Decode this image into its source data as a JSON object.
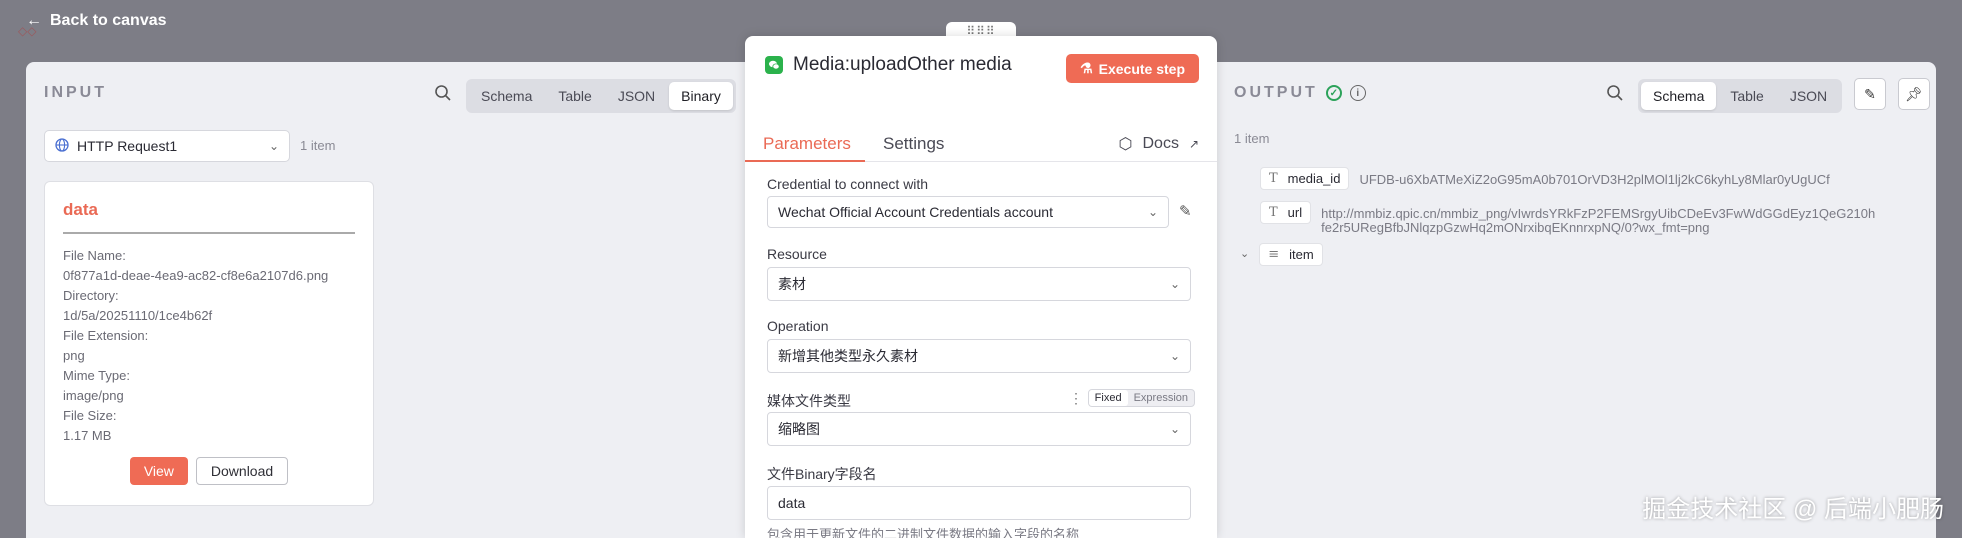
{
  "nav": {
    "back_label": "Back to canvas"
  },
  "input": {
    "header": "INPUT",
    "view_tabs": [
      "Schema",
      "Table",
      "JSON",
      "Binary"
    ],
    "active_tab": "Binary",
    "node_select": "HTTP Request1",
    "item_count": "1 item",
    "binary": {
      "title": "data",
      "lines": [
        "File Name:",
        "0f877a1d-deae-4ea9-ac82-cf8e6a2107d6.png",
        "Directory:",
        "1d/5a/20251110/1ce4b62f",
        "File Extension:",
        "png",
        "Mime Type:",
        "image/png",
        "File Size:",
        "1.17 MB"
      ],
      "view_label": "View",
      "download_label": "Download"
    }
  },
  "node": {
    "title": "Media:uploadOther media",
    "execute_label": "Execute step",
    "tabs": {
      "parameters": "Parameters",
      "settings": "Settings"
    },
    "docs_label": "Docs",
    "fields": {
      "credential_label": "Credential to connect with",
      "credential_value": "Wechat Official Account Credentials account",
      "resource_label": "Resource",
      "resource_value": "素材",
      "operation_label": "Operation",
      "operation_value": "新增其他类型永久素材",
      "media_type_label": "媒体文件类型",
      "media_type_value": "缩略图",
      "fixed_label": "Fixed",
      "expression_label": "Expression",
      "binary_field_label": "文件Binary字段名",
      "binary_field_value": "data",
      "binary_field_hint": "包含用于更新文件的二进制文件数据的输入字段的名称"
    }
  },
  "output": {
    "header": "OUTPUT",
    "view_tabs": [
      "Schema",
      "Table",
      "JSON"
    ],
    "active_tab": "Schema",
    "item_count": "1 item",
    "fields": [
      {
        "key": "media_id",
        "type_glyph": "T",
        "value": "UFDB-u6XbATMeXiZ2oG95mA0b701OrVD3H2plMOl1lj2kC6kyhLy8Mlar0yUgUCf"
      },
      {
        "key": "url",
        "type_glyph": "T",
        "value_line1": "http://mmbiz.qpic.cn/mmbiz_png/vIwrdsYRkFzP2FEMSrgyUibCDeEv3FwWdGGdEyz1QeG210h",
        "value_line2": "fe2r5URegBfbJNlqzpGzwHq2mONrxibqEKnnrxpNQ/0?wx_fmt=png"
      },
      {
        "key": "item",
        "type_glyph": "≡"
      }
    ]
  },
  "watermark": "掘金技术社区 @ 后端小肥肠",
  "colors": {
    "accent": "#ef6b55",
    "success": "#2ca25a",
    "wechat": "#2bb24c"
  }
}
